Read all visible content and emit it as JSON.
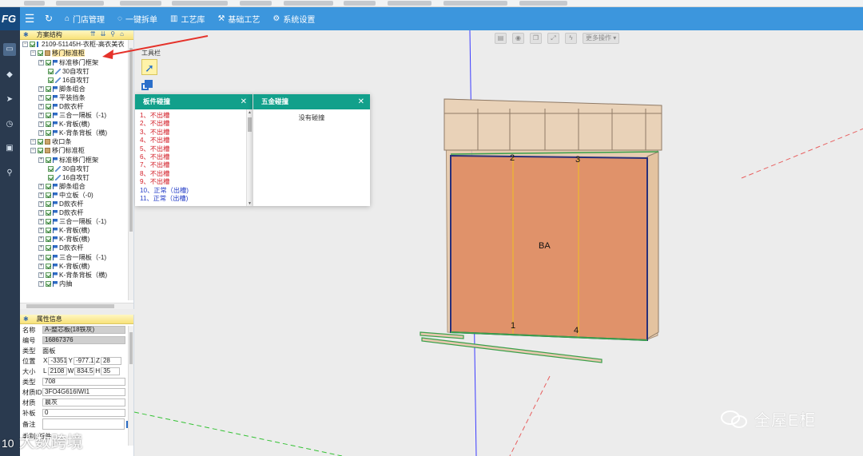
{
  "app": {
    "logo": "FG"
  },
  "topbar": {
    "menu_icon": "menu-icon",
    "refresh_icon": "refresh-icon",
    "items": [
      {
        "icon": "home-icon",
        "label": "门店管理"
      },
      {
        "icon": "split-icon",
        "label": "一键拆单"
      },
      {
        "icon": "library-icon",
        "label": "工艺库"
      },
      {
        "icon": "tool-icon",
        "label": "基础工艺"
      },
      {
        "icon": "gear-icon",
        "label": "系统设置"
      }
    ]
  },
  "tree_panel": {
    "title": "方案结构",
    "nodes": [
      {
        "label": "2109-51145H-衣柜-高衣美衣",
        "level": 0,
        "icon": "root"
      },
      {
        "label": "移门标准柜",
        "level": 1,
        "icon": "box",
        "selected": true
      },
      {
        "label": "标准移门框架",
        "level": 2,
        "icon": "flag"
      },
      {
        "label": "30自攻钉",
        "level": 3,
        "icon": "screw"
      },
      {
        "label": "16自攻钉",
        "level": 3,
        "icon": "screw"
      },
      {
        "label": "脚条组合",
        "level": 2,
        "icon": "flag"
      },
      {
        "label": "平装挡条",
        "level": 2,
        "icon": "flag"
      },
      {
        "label": "D款衣杆",
        "level": 2,
        "icon": "flag"
      },
      {
        "label": "三合一隔板（-1)",
        "level": 2,
        "icon": "flag"
      },
      {
        "label": "K-背板(横)",
        "level": 2,
        "icon": "flag"
      },
      {
        "label": "K-背条背板（横)",
        "level": 2,
        "icon": "flag"
      },
      {
        "label": "收口条",
        "level": 1,
        "icon": "box"
      },
      {
        "label": "移门标准柜",
        "level": 1,
        "icon": "box"
      },
      {
        "label": "标准移门框架",
        "level": 2,
        "icon": "flag"
      },
      {
        "label": "30自攻钉",
        "level": 3,
        "icon": "screw"
      },
      {
        "label": "16自攻钉",
        "level": 3,
        "icon": "screw"
      },
      {
        "label": "脚条组合",
        "level": 2,
        "icon": "flag"
      },
      {
        "label": "中立板（-0)",
        "level": 2,
        "icon": "flag"
      },
      {
        "label": "D款衣杆",
        "level": 2,
        "icon": "flag"
      },
      {
        "label": "D款衣杆",
        "level": 2,
        "icon": "flag"
      },
      {
        "label": "三合一隔板（-1)",
        "level": 2,
        "icon": "flag"
      },
      {
        "label": "K-背板(横)",
        "level": 2,
        "icon": "flag"
      },
      {
        "label": "K-背板(横)",
        "level": 2,
        "icon": "flag"
      },
      {
        "label": "D款衣杆",
        "level": 2,
        "icon": "flag"
      },
      {
        "label": "三合一隔板（-1)",
        "level": 2,
        "icon": "flag"
      },
      {
        "label": "K-背板(横)",
        "level": 2,
        "icon": "flag"
      },
      {
        "label": "K-背条背板（横)",
        "level": 2,
        "icon": "flag"
      },
      {
        "label": "内抽",
        "level": 2,
        "icon": "flag"
      }
    ]
  },
  "prop_panel": {
    "title": "属性信息",
    "name_label": "名称",
    "name_value": "A-整芯板(18铁灰)",
    "code_label": "编号",
    "code_value": "16867376",
    "type_label": "类型",
    "type_value": "面板",
    "pos_label": "位置",
    "pos_x": "-3351.",
    "pos_y": "-977.1",
    "pos_z": "28",
    "size_label": "大小",
    "size_l": "2108",
    "size_w": "834.5(",
    "size_h": "35",
    "kind_label": "类型",
    "kind_value": "708",
    "matid_label": "材质ID",
    "matid_value": "3FO4G616IWI1",
    "mat_label": "材质",
    "mat_value": "晨灰",
    "patch_label": "补板",
    "patch_value": "0",
    "note_label": "备注",
    "cat_label": "类别:",
    "cat_value": "板件"
  },
  "viewport": {
    "toolbar": [
      "save-icon",
      "target-icon",
      "layers-icon",
      "fit-icon",
      "flash-icon"
    ],
    "more_ops": "更多操作",
    "toolbox_title": "工具栏",
    "model_labels": {
      "p1": "1",
      "p2": "2",
      "p3": "3",
      "p4": "4",
      "pb": "BA"
    }
  },
  "board_popup": {
    "title": "板件碰撞",
    "items": [
      {
        "text": "1、不出槽",
        "ok": false
      },
      {
        "text": "2、不出槽",
        "ok": false
      },
      {
        "text": "3、不出槽",
        "ok": false
      },
      {
        "text": "4、不出槽",
        "ok": false
      },
      {
        "text": "5、不出槽",
        "ok": false
      },
      {
        "text": "6、不出槽",
        "ok": false
      },
      {
        "text": "7、不出槽",
        "ok": false
      },
      {
        "text": "8、不出槽",
        "ok": false
      },
      {
        "text": "9、不出槽",
        "ok": false
      },
      {
        "text": "10、正常（出槽)",
        "ok": true
      },
      {
        "text": "11、正常（出槽)",
        "ok": true
      }
    ]
  },
  "hardware_popup": {
    "title": "五金碰撞",
    "empty_text": "没有碰撞"
  },
  "watermark": {
    "right": "全屋E柜",
    "left": "大数跨境",
    "left_logo": "10"
  },
  "colors": {
    "topbar": "#3c96dd",
    "popup_header": "#12a08b",
    "panel_header": "#f8e27a",
    "door_orange": "#e0926a"
  }
}
